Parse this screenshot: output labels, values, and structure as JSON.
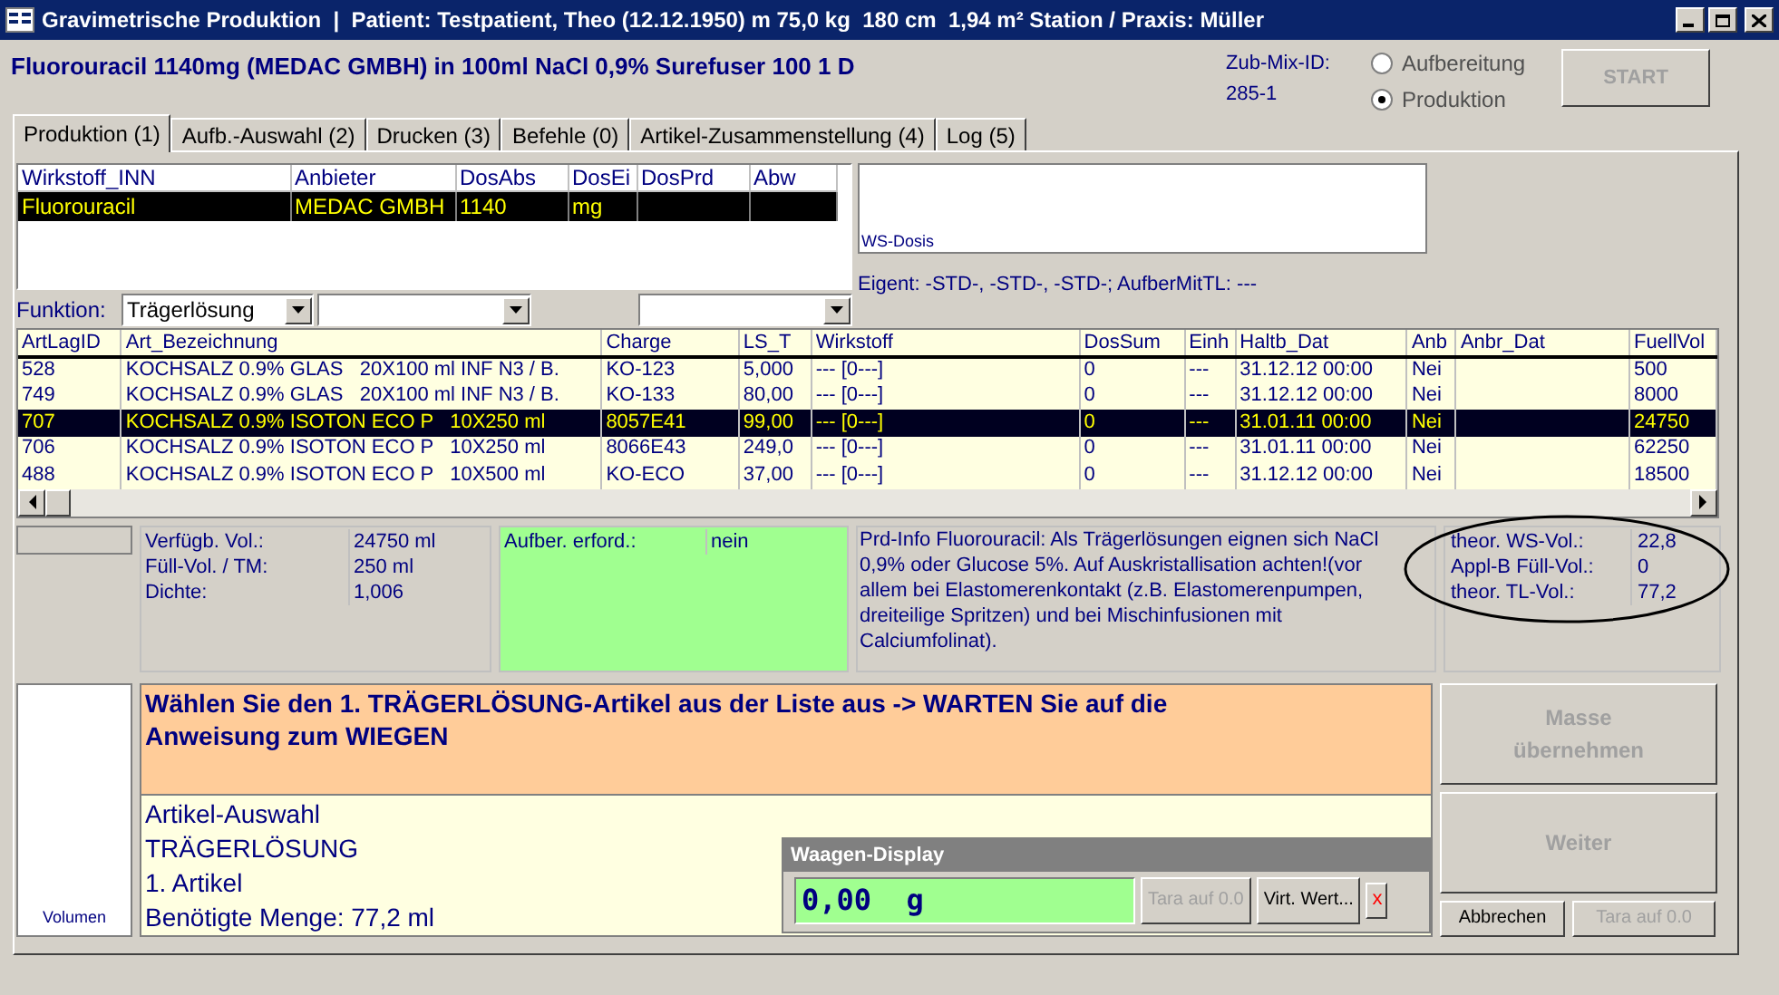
{
  "window": {
    "title": "Gravimetrische Produktion  |  Patient: Testpatient, Theo (12.12.1950) m 75,0 kg  180 cm  1,94 m² Station / Praxis: Müller"
  },
  "header": {
    "order": "Fluorouracil 1140mg (MEDAC GMBH) in 100ml NaCl 0,9% Surefuser 100 1 D",
    "zub_mix_label": "Zub-Mix-ID:",
    "zub_mix_id": "285-1",
    "modes": [
      {
        "label": "Aufbereitung",
        "selected": false
      },
      {
        "label": "Produktion",
        "selected": true
      }
    ],
    "start_button": {
      "label": "START",
      "disabled": true
    }
  },
  "tabs": [
    {
      "label": "Produktion (1)",
      "selected": true
    },
    {
      "label": "Aufb.-Auswahl (2)",
      "selected": false
    },
    {
      "label": "Drucken (3)",
      "selected": false
    },
    {
      "label": "Befehle (0)",
      "selected": false
    },
    {
      "label": "Artikel-Zusammenstellung (4)",
      "selected": false
    },
    {
      "label": "Log (5)",
      "selected": false
    }
  ],
  "substance_table": {
    "columns": [
      "Wirkstoff_INN",
      "Anbieter",
      "DosAbs",
      "DosEi",
      "DosPrd",
      "Abw"
    ],
    "rows": [
      {
        "cells": [
          "Fluorouracil",
          "MEDAC GMBH",
          "1140",
          "mg",
          "",
          ""
        ],
        "selected": true
      }
    ]
  },
  "ws_dosis": {
    "label": "WS-Dosis"
  },
  "eigent": "Eigent: -STD-, -STD-, -STD-; AufberMitTL: ---",
  "funktion": {
    "label": "Funktion:",
    "value": "Trägerlösung"
  },
  "article_table": {
    "columns": [
      "ArtLagID",
      "Art_Bezeichnung",
      "Charge",
      "LS_T",
      "Wirkstoff",
      "DosSum",
      "Einh",
      "Haltb_Dat",
      "Anb",
      "Anbr_Dat",
      "FuellVol"
    ],
    "rows": [
      {
        "cells": [
          "528",
          "KOCHSALZ 0.9% GLAS   20X100 ml INF N3 / B.",
          "KO-123",
          "5,000",
          "--- [0---]",
          "0",
          "---",
          "31.12.12 00:00",
          "Nei",
          "",
          "500"
        ],
        "selected": false
      },
      {
        "cells": [
          "749",
          "KOCHSALZ 0.9% GLAS   20X100 ml INF N3 / B.",
          "KO-133",
          "80,00",
          "--- [0---]",
          "0",
          "---",
          "31.12.12 00:00",
          "Nei",
          "",
          "8000"
        ],
        "selected": false
      },
      {
        "cells": [
          "707",
          "KOCHSALZ 0.9% ISOTON ECO P   10X250 ml",
          "8057E41",
          "99,00",
          "--- [0---]",
          "0",
          "---",
          "31.01.11 00:00",
          "Nei",
          "",
          "24750"
        ],
        "selected": true
      },
      {
        "cells": [
          "706",
          "KOCHSALZ 0.9% ISOTON ECO P   10X250 ml",
          "8066E43",
          "249,0",
          "--- [0---]",
          "0",
          "---",
          "31.01.11 00:00",
          "Nei",
          "",
          "62250"
        ],
        "selected": false
      },
      {
        "cells": [
          "488",
          "KOCHSALZ 0.9% ISOTON ECO P   10X500 ml",
          "KO-ECO",
          "37,00",
          "--- [0---]",
          "0",
          "---",
          "31.12.12 00:00",
          "Nei",
          "",
          "18500"
        ],
        "selected": false
      }
    ]
  },
  "stock_info": [
    {
      "label": "Verfügb. Vol.:",
      "value": "24750 ml"
    },
    {
      "label": "Füll-Vol. / TM:",
      "value": "250 ml"
    },
    {
      "label": "Dichte:",
      "value": "1,006"
    }
  ],
  "preparation": {
    "label": "Aufber. erford.:",
    "value": "nein"
  },
  "prd_info": "Prd-Info Fluorouracil: Als Trägerlösungen eignen sich NaCl 0,9% oder Glucose 5%. Auf Auskristallisation achten!(vor allem bei Elastomerenkontakt (z.B. Elastomerenpumpen, dreiteilige Spritzen) und bei Mischinfusionen mit Calciumfolinat).",
  "theoretical": [
    {
      "label": "theor. WS-Vol.:",
      "value": "22,8"
    },
    {
      "label": "Appl-B Füll-Vol.:",
      "value": "0"
    },
    {
      "label": "theor. TL-Vol.:",
      "value": "77,2"
    }
  ],
  "volumen_label": "Volumen",
  "instruction": "Wählen Sie den 1. TRÄGERLÖSUNG-Artikel aus der Liste aus -> WARTEN Sie auf die Anweisung zum WIEGEN",
  "selection_lines": [
    "Artikel-Auswahl",
    "TRÄGERLÖSUNG",
    "1. Artikel",
    "Benötigte Menge: 77,2 ml"
  ],
  "scale": {
    "title": "Waagen-Display",
    "reading": "0,00  g",
    "buttons": [
      {
        "label": "Tara auf 0.0",
        "disabled": true
      },
      {
        "label": "Virt. Wert...",
        "disabled": false
      }
    ],
    "close": "x"
  },
  "actions": [
    {
      "label": "Masse übernehmen",
      "disabled": true,
      "kind": "large"
    },
    {
      "label": "Weiter",
      "disabled": true,
      "kind": "large"
    },
    {
      "label": "Abbrechen",
      "disabled": false,
      "kind": "small"
    },
    {
      "label": "Tara auf 0.0",
      "disabled": true,
      "kind": "small"
    }
  ]
}
